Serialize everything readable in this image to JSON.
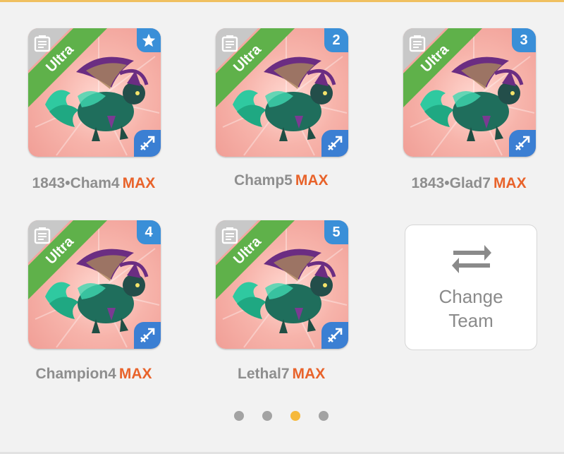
{
  "team_cards": [
    {
      "name": "1843•Cham4",
      "level": "MAX",
      "rarity": "Ultra",
      "badge": "",
      "badge_icon": "star-icon"
    },
    {
      "name": "Champ5",
      "level": "MAX",
      "rarity": "Ultra",
      "badge": "2",
      "badge_icon": ""
    },
    {
      "name": "1843•Glad7",
      "level": "MAX",
      "rarity": "Ultra",
      "badge": "3",
      "badge_icon": ""
    },
    {
      "name": "Champion4",
      "level": "MAX",
      "rarity": "Ultra",
      "badge": "4",
      "badge_icon": ""
    },
    {
      "name": "Lethal7",
      "level": "MAX",
      "rarity": "Ultra",
      "badge": "5",
      "badge_icon": ""
    }
  ],
  "change_team": {
    "label_line1": "Change",
    "label_line2": "Team",
    "icon": "swap-arrows-icon"
  },
  "pagination": {
    "total": 4,
    "active_index": 2
  },
  "colors": {
    "rarity_green": "#5fb14a",
    "badge_blue": "#3a8fd8",
    "max_orange": "#e8632b",
    "active_dot": "#f6b93b",
    "inactive_dot": "#a3a3a3"
  }
}
